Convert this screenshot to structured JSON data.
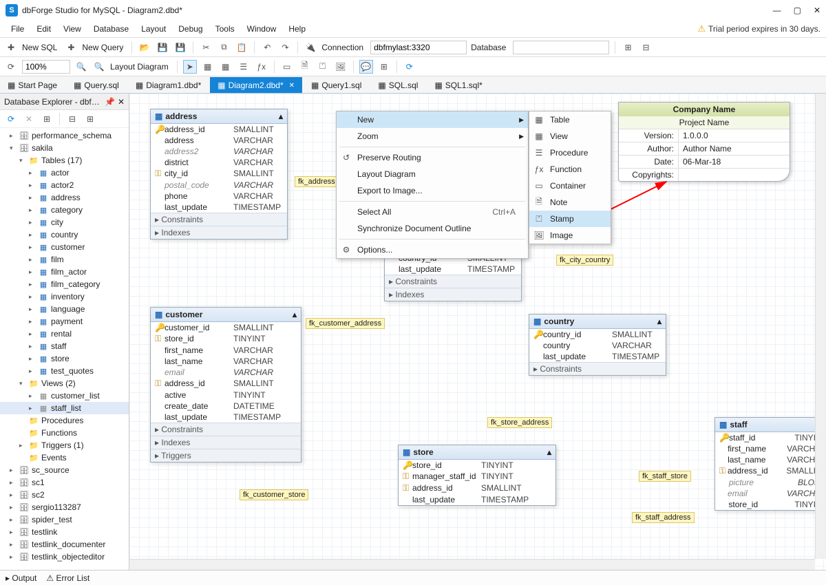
{
  "titlebar": {
    "app": "dbForge Studio for MySQL",
    "doc": "Diagram2.dbd*"
  },
  "win_controls": {
    "min": "—",
    "max": "▢",
    "close": "✕"
  },
  "menu": [
    "File",
    "Edit",
    "View",
    "Database",
    "Layout",
    "Debug",
    "Tools",
    "Window",
    "Help"
  ],
  "trial_msg": "Trial period expires in 30 days.",
  "toolbar1": {
    "new_sql": "New SQL",
    "new_query": "New Query",
    "connection_label": "Connection",
    "connection_value": "dbfmylast:3320",
    "database_label": "Database",
    "database_value": ""
  },
  "toolbar2": {
    "zoom": "100%",
    "layout_btn": "Layout Diagram"
  },
  "doc_tabs": [
    {
      "label": "Start Page",
      "active": false
    },
    {
      "label": "Query.sql",
      "active": false
    },
    {
      "label": "Diagram1.dbd*",
      "active": false
    },
    {
      "label": "Diagram2.dbd*",
      "active": true
    },
    {
      "label": "Query1.sql",
      "active": false
    },
    {
      "label": "SQL.sql",
      "active": false
    },
    {
      "label": "SQL1.sql*",
      "active": false
    }
  ],
  "explorer": {
    "title": "Database Explorer - dbfmyl…",
    "tree": [
      {
        "d": 1,
        "t": "db",
        "c": "▸",
        "l": "performance_schema"
      },
      {
        "d": 1,
        "t": "db",
        "c": "▾",
        "l": "sakila"
      },
      {
        "d": 2,
        "t": "folder",
        "c": "▾",
        "l": "Tables (17)"
      },
      {
        "d": 3,
        "t": "table",
        "c": "▸",
        "l": "actor"
      },
      {
        "d": 3,
        "t": "table",
        "c": "▸",
        "l": "actor2"
      },
      {
        "d": 3,
        "t": "table",
        "c": "▸",
        "l": "address"
      },
      {
        "d": 3,
        "t": "table",
        "c": "▸",
        "l": "category"
      },
      {
        "d": 3,
        "t": "table",
        "c": "▸",
        "l": "city"
      },
      {
        "d": 3,
        "t": "table",
        "c": "▸",
        "l": "country"
      },
      {
        "d": 3,
        "t": "table",
        "c": "▸",
        "l": "customer"
      },
      {
        "d": 3,
        "t": "table",
        "c": "▸",
        "l": "film"
      },
      {
        "d": 3,
        "t": "table",
        "c": "▸",
        "l": "film_actor"
      },
      {
        "d": 3,
        "t": "table",
        "c": "▸",
        "l": "film_category"
      },
      {
        "d": 3,
        "t": "table",
        "c": "▸",
        "l": "inventory"
      },
      {
        "d": 3,
        "t": "table",
        "c": "▸",
        "l": "language"
      },
      {
        "d": 3,
        "t": "table",
        "c": "▸",
        "l": "payment"
      },
      {
        "d": 3,
        "t": "table",
        "c": "▸",
        "l": "rental"
      },
      {
        "d": 3,
        "t": "table",
        "c": "▸",
        "l": "staff"
      },
      {
        "d": 3,
        "t": "table",
        "c": "▸",
        "l": "store"
      },
      {
        "d": 3,
        "t": "table",
        "c": "▸",
        "l": "test_quotes"
      },
      {
        "d": 2,
        "t": "folder",
        "c": "▾",
        "l": "Views (2)"
      },
      {
        "d": 3,
        "t": "view",
        "c": "▸",
        "l": "customer_list"
      },
      {
        "d": 3,
        "t": "view",
        "c": "▸",
        "l": "staff_list",
        "sel": true
      },
      {
        "d": 2,
        "t": "folder",
        "c": " ",
        "l": "Procedures"
      },
      {
        "d": 2,
        "t": "folder",
        "c": " ",
        "l": "Functions"
      },
      {
        "d": 2,
        "t": "folder",
        "c": "▸",
        "l": "Triggers (1)"
      },
      {
        "d": 2,
        "t": "folder",
        "c": " ",
        "l": "Events"
      },
      {
        "d": 1,
        "t": "db",
        "c": "▸",
        "l": "sc_source"
      },
      {
        "d": 1,
        "t": "db",
        "c": "▸",
        "l": "sc1"
      },
      {
        "d": 1,
        "t": "db",
        "c": "▸",
        "l": "sc2"
      },
      {
        "d": 1,
        "t": "db",
        "c": "▸",
        "l": "sergio113287"
      },
      {
        "d": 1,
        "t": "db",
        "c": "▸",
        "l": "spider_test"
      },
      {
        "d": 1,
        "t": "db",
        "c": "▸",
        "l": "testlink"
      },
      {
        "d": 1,
        "t": "db",
        "c": "▸",
        "l": "testlink_documenter"
      },
      {
        "d": 1,
        "t": "db",
        "c": "▸",
        "l": "testlink_objecteditor"
      }
    ]
  },
  "entities": {
    "address": {
      "title": "address",
      "rows": [
        {
          "k": "🔑",
          "c": "address_id",
          "t": "SMALLINT"
        },
        {
          "k": "",
          "c": "address",
          "t": "VARCHAR"
        },
        {
          "k": "",
          "c": "address2",
          "t": "VARCHAR",
          "f": true
        },
        {
          "k": "",
          "c": "district",
          "t": "VARCHAR"
        },
        {
          "k": "⚿",
          "c": "city_id",
          "t": "SMALLINT"
        },
        {
          "k": "",
          "c": "postal_code",
          "t": "VARCHAR",
          "f": true
        },
        {
          "k": "",
          "c": "phone",
          "t": "VARCHAR"
        },
        {
          "k": "",
          "c": "last_update",
          "t": "TIMESTAMP"
        }
      ],
      "secs": [
        "Constraints",
        "Indexes"
      ]
    },
    "customer": {
      "title": "customer",
      "rows": [
        {
          "k": "🔑",
          "c": "customer_id",
          "t": "SMALLINT"
        },
        {
          "k": "⚿",
          "c": "store_id",
          "t": "TINYINT"
        },
        {
          "k": "",
          "c": "first_name",
          "t": "VARCHAR"
        },
        {
          "k": "",
          "c": "last_name",
          "t": "VARCHAR"
        },
        {
          "k": "",
          "c": "email",
          "t": "VARCHAR",
          "f": true
        },
        {
          "k": "⚿",
          "c": "address_id",
          "t": "SMALLINT"
        },
        {
          "k": "",
          "c": "active",
          "t": "TINYINT"
        },
        {
          "k": "",
          "c": "create_date",
          "t": "DATETIME"
        },
        {
          "k": "",
          "c": "last_update",
          "t": "TIMESTAMP"
        }
      ],
      "secs": [
        "Constraints",
        "Indexes",
        "Triggers"
      ]
    },
    "city_partial": {
      "rows": [
        {
          "k": "",
          "c": "country_id",
          "t": "SMALLINT"
        },
        {
          "k": "",
          "c": "last_update",
          "t": "TIMESTAMP"
        }
      ],
      "secs": [
        "Constraints",
        "Indexes"
      ]
    },
    "country": {
      "title": "country",
      "rows": [
        {
          "k": "🔑",
          "c": "country_id",
          "t": "SMALLINT"
        },
        {
          "k": "",
          "c": "country",
          "t": "VARCHAR"
        },
        {
          "k": "",
          "c": "last_update",
          "t": "TIMESTAMP"
        }
      ],
      "secs": [
        "Constraints"
      ]
    },
    "store": {
      "title": "store",
      "rows": [
        {
          "k": "🔑",
          "c": "store_id",
          "t": "TINYINT"
        },
        {
          "k": "⚿",
          "c": "manager_staff_id",
          "t": "TINYINT"
        },
        {
          "k": "⚿",
          "c": "address_id",
          "t": "SMALLINT"
        },
        {
          "k": "",
          "c": "last_update",
          "t": "TIMESTAMP"
        }
      ],
      "secs": []
    },
    "staff": {
      "title": "staff",
      "rows": [
        {
          "k": "🔑",
          "c": "staff_id",
          "t": "TINYINT"
        },
        {
          "k": "",
          "c": "first_name",
          "t": "VARCHAR"
        },
        {
          "k": "",
          "c": "last_name",
          "t": "VARCHAR"
        },
        {
          "k": "⚿",
          "c": "address_id",
          "t": "SMALLINT"
        },
        {
          "k": "",
          "c": "picture",
          "t": "BLOB",
          "f": true
        },
        {
          "k": "",
          "c": "email",
          "t": "VARCHAR",
          "f": true
        },
        {
          "k": "",
          "c": "store_id",
          "t": "TINYINT"
        }
      ],
      "secs": []
    }
  },
  "fk_labels": {
    "addr": "fk_address",
    "cust_addr": "fk_customer_address",
    "city_country": "fk_city_country",
    "store_addr": "fk_store_address",
    "cust_store": "fk_customer_store",
    "staff_store": "fk_staff_store",
    "staff_addr": "fk_staff_address"
  },
  "stamp": {
    "company": "Company Name",
    "project": "Project Name",
    "rows": [
      {
        "k": "Version:",
        "v": "1.0.0.0"
      },
      {
        "k": "Author:",
        "v": "Author Name"
      },
      {
        "k": "Date:",
        "v": "06-Mar-18"
      },
      {
        "k": "Copyrights:",
        "v": ""
      }
    ]
  },
  "ctx_main": [
    {
      "l": "New",
      "sub": true,
      "hover": true
    },
    {
      "l": "Zoom",
      "sub": true
    },
    {
      "sep": true
    },
    {
      "l": "Preserve Routing",
      "ico": "↺"
    },
    {
      "l": "Layout Diagram"
    },
    {
      "l": "Export to Image..."
    },
    {
      "sep": true
    },
    {
      "l": "Select All",
      "kb": "Ctrl+A"
    },
    {
      "l": "Synchronize Document Outline"
    },
    {
      "sep": true
    },
    {
      "l": "Options...",
      "ico": "⚙"
    }
  ],
  "ctx_new": [
    {
      "l": "Table",
      "ico": "▦"
    },
    {
      "l": "View",
      "ico": "▦"
    },
    {
      "l": "Procedure",
      "ico": "☰"
    },
    {
      "l": "Function",
      "ico": "ƒx"
    },
    {
      "l": "Container",
      "ico": "▭"
    },
    {
      "l": "Note",
      "ico": "🗎"
    },
    {
      "l": "Stamp",
      "ico": "⏍",
      "hover": true
    },
    {
      "l": "Image",
      "ico": "🖼"
    }
  ],
  "status": {
    "output": "Output",
    "errors": "Error List"
  }
}
